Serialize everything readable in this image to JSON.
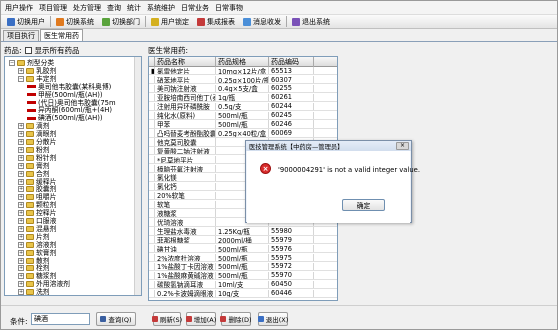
{
  "menu": [
    "用户操作",
    "项目管理",
    "处方管理",
    "查询",
    "统计",
    "系统维护",
    "日常业务",
    "日常事物"
  ],
  "toolbar": [
    {
      "label": "切换用户",
      "icon": "switch-user-icon",
      "color": "#3a6fc4"
    },
    {
      "label": "切换系统",
      "icon": "switch-system-icon",
      "color": "#e07a1f"
    },
    {
      "label": "切换部门",
      "icon": "switch-dept-icon",
      "color": "#5aa33c"
    },
    {
      "label": "用户锁定",
      "icon": "lock-icon",
      "color": "#d4b020"
    },
    {
      "label": "集成报表",
      "icon": "report-icon",
      "color": "#c43a3a"
    },
    {
      "label": "消息收发",
      "icon": "message-icon",
      "color": "#4b8fd8"
    },
    {
      "label": "退出系统",
      "icon": "exit-icon",
      "color": "#7a52b8"
    }
  ],
  "tabs": [
    "项目执行",
    "医生常用药"
  ],
  "left": {
    "label": "药品:",
    "checkbox_label": "显示所有药品"
  },
  "tree": [
    {
      "level": 0,
      "expander": "−",
      "type": "folder",
      "label": "剂型分类"
    },
    {
      "level": 1,
      "expander": "+",
      "type": "folder",
      "label": "乳胶剂"
    },
    {
      "level": 1,
      "expander": "−",
      "type": "folder",
      "label": "丰定剂"
    },
    {
      "level": 2,
      "expander": "",
      "type": "med",
      "label": "奥司他韦胶囊(某科奥博)"
    },
    {
      "level": 2,
      "expander": "",
      "type": "med",
      "label": "甲醛(500ml/瓶(AH))"
    },
    {
      "level": 2,
      "expander": "",
      "type": "med",
      "label": "(代日)奥司他韦胶囊(75m"
    },
    {
      "level": 2,
      "expander": "",
      "type": "med",
      "label": "异丙酮(600ml/瓶+(4H)"
    },
    {
      "level": 2,
      "expander": "",
      "type": "med",
      "label": "碘酒(500ml/瓶(AH))"
    },
    {
      "level": 1,
      "expander": "+",
      "type": "folder",
      "label": "滴剂"
    },
    {
      "level": 1,
      "expander": "+",
      "type": "folder",
      "label": "滴眼剂"
    },
    {
      "level": 1,
      "expander": "+",
      "type": "folder",
      "label": "分散片"
    },
    {
      "level": 1,
      "expander": "+",
      "type": "folder",
      "label": "粉剂"
    },
    {
      "level": 1,
      "expander": "+",
      "type": "folder",
      "label": "粉针剂"
    },
    {
      "level": 1,
      "expander": "+",
      "type": "folder",
      "label": "膏剂"
    },
    {
      "level": 1,
      "expander": "+",
      "type": "folder",
      "label": "合剂"
    },
    {
      "level": 1,
      "expander": "+",
      "type": "folder",
      "label": "缓释片"
    },
    {
      "level": 1,
      "expander": "+",
      "type": "folder",
      "label": "胶囊剂"
    },
    {
      "level": 1,
      "expander": "+",
      "type": "folder",
      "label": "咀嚼片"
    },
    {
      "level": 1,
      "expander": "+",
      "type": "folder",
      "label": "颗粒剂"
    },
    {
      "level": 1,
      "expander": "+",
      "type": "folder",
      "label": "控释片"
    },
    {
      "level": 1,
      "expander": "+",
      "type": "folder",
      "label": "口服液"
    },
    {
      "level": 1,
      "expander": "+",
      "type": "folder",
      "label": "混悬剂"
    },
    {
      "level": 1,
      "expander": "+",
      "type": "folder",
      "label": "片剂"
    },
    {
      "level": 1,
      "expander": "+",
      "type": "folder",
      "label": "溶液剂"
    },
    {
      "level": 1,
      "expander": "+",
      "type": "folder",
      "label": "软膏剂"
    },
    {
      "level": 1,
      "expander": "+",
      "type": "folder",
      "label": "散剂"
    },
    {
      "level": 1,
      "expander": "+",
      "type": "folder",
      "label": "栓剂"
    },
    {
      "level": 1,
      "expander": "+",
      "type": "folder",
      "label": "糖浆剂"
    },
    {
      "level": 1,
      "expander": "+",
      "type": "folder",
      "label": "外用溶液剂"
    },
    {
      "level": 1,
      "expander": "+",
      "type": "folder",
      "label": "洗剂"
    }
  ],
  "grid": {
    "title": "医生常用药:",
    "columns": [
      "",
      "药品名称",
      "药品规格",
      "药品编码",
      ""
    ],
    "rows": [
      [
        "■",
        "氯雷他定片",
        "10mg×12片/盒",
        "65513",
        ""
      ],
      [
        "",
        "硝苯地平片",
        "0.25g×100片/瓶",
        "60307",
        ""
      ],
      [
        "",
        "美司钠注射液",
        "0.4g×5支/盒",
        "60255",
        ""
      ],
      [
        "",
        "亚胺培南西司他丁(泰能)",
        "1g/瓶",
        "60261",
        ""
      ],
      [
        "",
        "注射用异环磷酰胺",
        "0.5g/支",
        "60244",
        ""
      ],
      [
        "",
        "纯化水(原料)",
        "500ml/瓶",
        "60245",
        ""
      ],
      [
        "",
        "甲苯",
        "500ml/瓶",
        "60246",
        ""
      ],
      [
        "",
        "凸吗替麦考酚酯胶囊",
        "0.25g×40粒/盒",
        "60069",
        ""
      ],
      [
        "",
        "他克莫司胶囊",
        "",
        "",
        ""
      ],
      [
        "",
        "复黄酸二钠注射液",
        "",
        "",
        ""
      ],
      [
        "",
        "*尼莫地平片",
        "",
        "",
        ""
      ],
      [
        "",
        "樟脑芬氟注射液",
        "",
        "",
        ""
      ],
      [
        "",
        "氯化镁",
        "",
        "",
        ""
      ],
      [
        "",
        "氯化钙",
        "",
        "",
        ""
      ],
      [
        "",
        "20%软笔",
        "",
        "",
        ""
      ],
      [
        "",
        "软笔",
        "",
        "",
        ""
      ],
      [
        "",
        "液糖浆",
        "",
        "",
        ""
      ],
      [
        "",
        "优琦溶液",
        "",
        "",
        ""
      ],
      [
        "",
        "生理盐水毒液",
        "1.25Kg/瓶",
        "55980",
        ""
      ],
      [
        "",
        "菲那根糖浆",
        "2000ml/桶",
        "55979",
        ""
      ],
      [
        "",
        "碘甘油",
        "500ml/瓶",
        "55976",
        ""
      ],
      [
        "",
        "2%浓度杜溶液",
        "500ml/瓶",
        "55975",
        ""
      ],
      [
        "",
        "1%盐酸丁卡因溶液",
        "500ml/瓶",
        "55972",
        ""
      ],
      [
        "",
        "1%盐酸麻黄碱溶液",
        "500ml/瓶",
        "55970",
        ""
      ],
      [
        "",
        "碳酸氢钠滴耳液",
        "10ml/支",
        "60450",
        ""
      ],
      [
        "",
        "0.2%卡波姆滴眼液",
        "10g/支",
        "60446",
        ""
      ]
    ]
  },
  "bottom": {
    "cond_label": "条件:",
    "cond_value": "碘酒",
    "buttons": [
      {
        "label": "查询(Q)",
        "icon": "search-icon",
        "color": "#3a5fa0"
      },
      {
        "label": "刷新(S)",
        "icon": "refresh-icon",
        "color": "#c43a3a"
      },
      {
        "label": "增加(A)",
        "icon": "add-icon",
        "color": "#c43a3a"
      },
      {
        "label": "删除(D)",
        "icon": "delete-icon",
        "color": "#c43a3a"
      },
      {
        "label": "退出(X)",
        "icon": "exit-icon",
        "color": "#3a6fc4"
      }
    ]
  },
  "dialog": {
    "title": "医技管理系统【中药房—管理员】",
    "close": "×",
    "message": "'9000004291' is not a valid integer value.",
    "ok": "确定"
  }
}
